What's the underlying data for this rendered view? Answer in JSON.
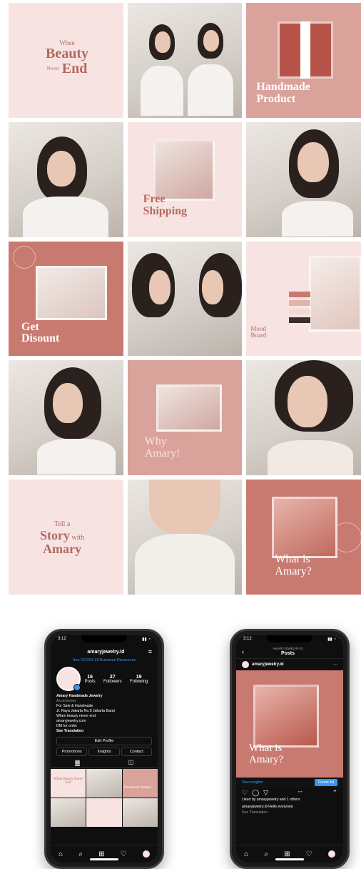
{
  "grid": {
    "t1": {
      "line1": "When",
      "line2": "Beauty",
      "line3": "Never",
      "line4": "End"
    },
    "t3": {
      "line1": "Handmade",
      "line2": "Product"
    },
    "t5": {
      "line1": "Free",
      "line2": "Shipping"
    },
    "t7": {
      "line1": "Get",
      "line2": "Disount"
    },
    "t9": {
      "line1": "Mood",
      "line2": "Board"
    },
    "t11": {
      "line1": "Why",
      "line2": "Amary!"
    },
    "t13": {
      "line1": "Tell a",
      "line2": "Story",
      "line3": "with",
      "line4": "Amary"
    },
    "t15": {
      "line1": "What is",
      "line2": "Amary?"
    }
  },
  "phone_profile": {
    "time": "3:12",
    "username": "amaryjewelry.id",
    "covid_link": "See COVID-19 Business Resources",
    "stats": [
      {
        "value": "16",
        "label": "Posts"
      },
      {
        "value": "27",
        "label": "Followers"
      },
      {
        "value": "19",
        "label": "Following"
      }
    ],
    "bio_name": "Amary Handmade Jewelry",
    "bio_category": "Accessories",
    "bio_lines": [
      "For Sale & Handmade",
      "Jl. Raya Jakarta No.9 Jakarta Barat",
      "When beauty never end",
      "amaryjewelry.com",
      "DM for order",
      "See Translation"
    ],
    "edit_profile": "Edit Profile",
    "promotions": "Promotions",
    "insights": "Insights",
    "contact": "Contact",
    "mini_grid_text": [
      "When Beauty Never End",
      "",
      "Handmade Product"
    ]
  },
  "phone_post": {
    "time": "3:12",
    "header_user": "AMARYJEWELRY.ID",
    "header_title": "Posts",
    "post_user": "amaryjewelry.id",
    "post_line1": "What is",
    "post_line2": "Amary?",
    "view_insights": "View Insights",
    "create_ad": "Create Ad",
    "liked_by": "Liked by amaryjewelry and 1 others",
    "caption": "amaryjewelry.id Hello everyone",
    "see_translation": "See Translation"
  },
  "colors": {
    "rose": "#c97a70",
    "blush": "#f7e4e2",
    "dusty": "#d9a29a",
    "accent_blue": "#3897f0"
  }
}
